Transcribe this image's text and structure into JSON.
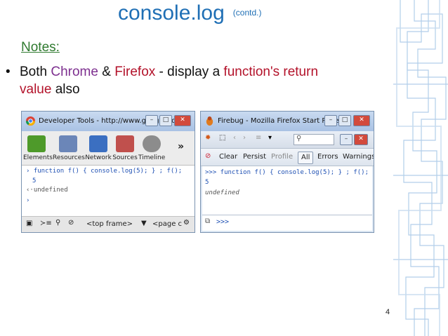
{
  "slide": {
    "title": "console.log",
    "title_suffix": "(contd.)",
    "notes_label": "Notes:",
    "bullet": {
      "prefix": "Both ",
      "chrome": "Chrome",
      "amp": " & ",
      "firefox": "Firefox",
      "middle": " - display a ",
      "function_return": "function's return",
      "value": "value",
      "end": " also"
    },
    "page_number": "4",
    "colors": {
      "title": "#1f6fb5",
      "notes": "#2f7a2f",
      "highlight_red": "#b3122a",
      "highlight_purple": "#7d2f8f"
    }
  },
  "chrome_devtools": {
    "window_title": "Developer Tools - http://www.google.co.i...",
    "tools": [
      "Elements",
      "Resources",
      "Network",
      "Sources",
      "Timeline"
    ],
    "more": "»",
    "console_lines": [
      {
        "prompt": "›",
        "text": "function f() { console.log(5); } ; f();"
      },
      {
        "prompt": "",
        "text": "5"
      },
      {
        "prompt": "‹·",
        "text": "undefined"
      },
      {
        "prompt": "›",
        "text": ""
      }
    ],
    "frame_select": "<top frame>",
    "page_select": "<page c"
  },
  "firebug": {
    "window_title": "Firebug - Mozilla Firefox Start Page",
    "toolbar": {
      "clear": "Clear",
      "persist": "Persist",
      "profile": "Profile",
      "all": "All",
      "errors": "Errors",
      "warnings": "Warnings"
    },
    "console_lines": [
      {
        "text": ">>> function f() { console.log(5); } ; f();"
      },
      {
        "text": "5"
      },
      {
        "text": "undefined"
      }
    ],
    "command_prompt": ">>>"
  }
}
